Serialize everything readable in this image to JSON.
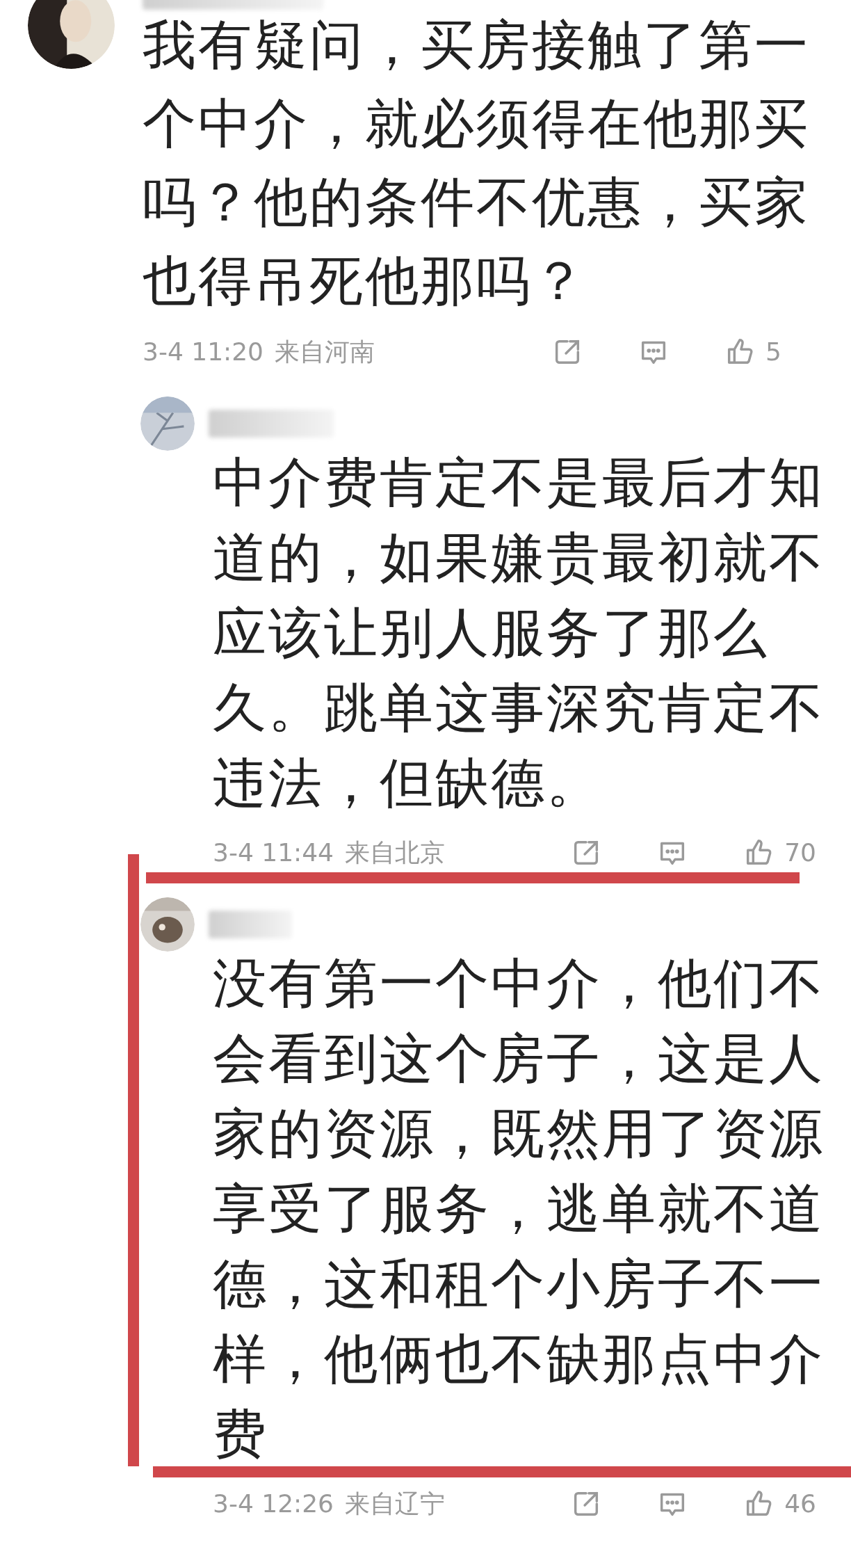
{
  "comments": [
    {
      "kind": "comment",
      "text": "我有疑问，买房接触了第一个中介，就必须得在他那买吗？他的条件不优惠，买家也得吊死他那吗？",
      "time": "3-4 11:20",
      "location": "来自河南",
      "likes": "5"
    },
    {
      "kind": "reply",
      "text": "中介费肯定不是最后才知道的，如果嫌贵最初就不应该让别人服务了那么久。跳单这事深究肯定不违法，但缺德。",
      "time": "3-4 11:44",
      "location": "来自北京",
      "likes": "70"
    },
    {
      "kind": "reply",
      "text": "没有第一个中介，他们不会看到这个房子，这是人家的资源，既然用了资源享受了服务，逃单就不道德，这和租个小房子不一样，他俩也不缺那点中介费",
      "time": "3-4 12:26",
      "location": "来自辽宁",
      "likes": "46"
    }
  ]
}
